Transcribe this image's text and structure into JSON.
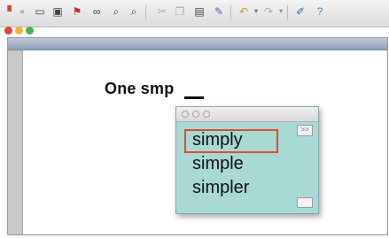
{
  "toolbar": {
    "icons": [
      "new-document",
      "open",
      "save",
      "flag",
      "binoculars",
      "zoom-out",
      "zoom-in",
      "cut",
      "copy",
      "paste",
      "brush",
      "undo",
      "redo",
      "edit",
      "help"
    ]
  },
  "document": {
    "text": "One smp"
  },
  "popup": {
    "suggestions": [
      "simply",
      "simple",
      "simpler"
    ],
    "more_label": ">>"
  },
  "colors": {
    "popup_background": "#a9d9d4",
    "selection_border": "#e24a2e",
    "dot_red": "#e0443e",
    "dot_yellow": "#f0b23a",
    "dot_green": "#49b24a"
  }
}
